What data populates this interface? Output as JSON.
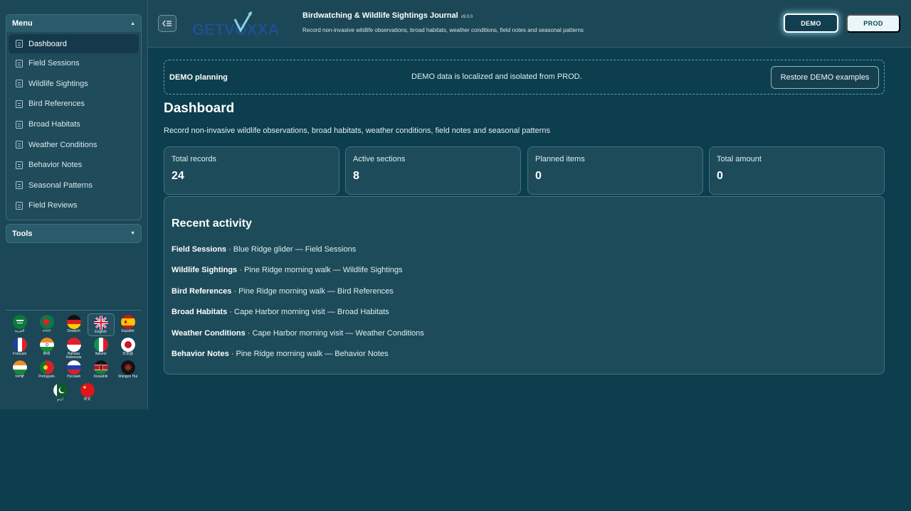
{
  "sidebar": {
    "menu_title": "Menu",
    "items": [
      {
        "label": "Dashboard",
        "active": true
      },
      {
        "label": "Field Sessions"
      },
      {
        "label": "Wildlife Sightings"
      },
      {
        "label": "Bird References"
      },
      {
        "label": "Broad Habitats"
      },
      {
        "label": "Weather Conditions"
      },
      {
        "label": "Behavior Notes"
      },
      {
        "label": "Seasonal Patterns"
      },
      {
        "label": "Field Reviews"
      }
    ],
    "tools_title": "Tools",
    "languages": [
      {
        "label": "العربية",
        "flag": "saudi-arabia-flag"
      },
      {
        "label": "বাংলা",
        "flag": "bangladesh-flag"
      },
      {
        "label": "Deutsch",
        "flag": "germany-flag"
      },
      {
        "label": "English",
        "flag": "uk-flag",
        "selected": true
      },
      {
        "label": "Español",
        "flag": "spain-flag"
      },
      {
        "label": "Français",
        "flag": "france-flag"
      },
      {
        "label": "हिन्दी",
        "flag": "india-flag"
      },
      {
        "label": "Bahasa Indonesia",
        "flag": "indonesia-flag"
      },
      {
        "label": "Italiano",
        "flag": "italy-flag"
      },
      {
        "label": "日本語",
        "flag": "japan-flag"
      },
      {
        "label": "ਪੰਜਾਬੀ",
        "flag": "india-flag"
      },
      {
        "label": "Português",
        "flag": "portugal-flag"
      },
      {
        "label": "Русский",
        "flag": "russia-flag"
      },
      {
        "label": "Kiswahili",
        "flag": "kenya-flag"
      },
      {
        "label": "Shingon Hui",
        "flag": "shingon-flag"
      },
      {
        "label": "اردو",
        "flag": "pakistan-flag"
      },
      {
        "label": "中文",
        "flag": "china-flag"
      }
    ]
  },
  "header": {
    "logo_text": "GETVOXXA",
    "title": "Birdwatching & Wildlife Sightings Journal",
    "version": "v9.0.0",
    "subtitle": "Record non-invasive wildlife observations, broad habitats, weather conditions, field notes and seasonal patterns",
    "demo_label": "DEMO",
    "prod_label": "PROD"
  },
  "notice": {
    "title": "DEMO planning",
    "message": "DEMO data is localized and isolated from PROD.",
    "restore_label": "Restore DEMO examples"
  },
  "main": {
    "title": "Dashboard",
    "description": "Record non-invasive wildlife observations, broad habitats, weather conditions, field notes and seasonal patterns",
    "stats": [
      {
        "label": "Total records",
        "value": "24"
      },
      {
        "label": "Active sections",
        "value": "8"
      },
      {
        "label": "Planned items",
        "value": "0"
      },
      {
        "label": "Total amount",
        "value": "0"
      }
    ],
    "activity_title": "Recent activity",
    "activity": [
      {
        "section": "Field Sessions",
        "text": " · Blue Ridge glider — Field Sessions"
      },
      {
        "section": "Wildlife Sightings",
        "text": " · Pine Ridge morning walk — Wildlife Sightings"
      },
      {
        "section": "Bird References",
        "text": " · Pine Ridge morning walk — Bird References"
      },
      {
        "section": "Broad Habitats",
        "text": " · Cape Harbor morning visit — Broad Habitats"
      },
      {
        "section": "Weather Conditions",
        "text": " · Cape Harbor morning visit — Weather Conditions"
      },
      {
        "section": "Behavior Notes",
        "text": " · Pine Ridge morning walk — Behavior Notes"
      }
    ]
  },
  "colors": {
    "background": "#0c3e4e",
    "panel": "#1c4756",
    "card": "#1d4b5a",
    "accent": "#5aa8bc"
  }
}
